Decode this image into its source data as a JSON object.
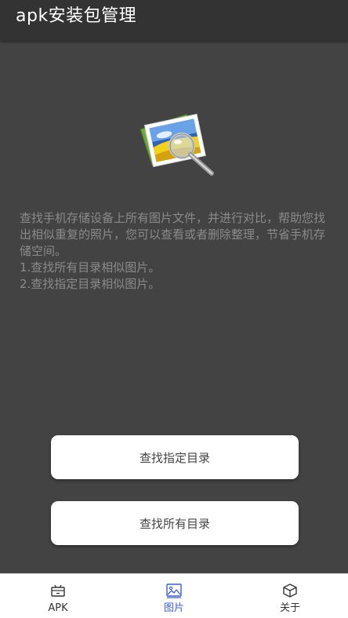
{
  "appbar": {
    "title": "apk安装包管理"
  },
  "hero": {
    "icon": "photo-search-icon"
  },
  "description": {
    "paragraph": "查找手机存储设备上所有图片文件，并进行对比，帮助您找出相似重复的照片，您可以查看或者删除整理，节省手机存储空间。",
    "item1": "1.查找所有目录相似图片。",
    "item2": "2.查找指定目录相似图片。"
  },
  "buttons": {
    "find_specific": "查找指定目录",
    "find_all": "查找所有目录"
  },
  "bottom_nav": {
    "items": [
      {
        "label": "APK",
        "icon": "apk-box-icon",
        "active": false
      },
      {
        "label": "图片",
        "icon": "image-icon",
        "active": true
      },
      {
        "label": "关于",
        "icon": "cube-icon",
        "active": false
      }
    ],
    "active_color": "#3a5fd9"
  },
  "colors": {
    "background": "#434343",
    "appbar": "#333333",
    "text_muted": "#8a8a8a"
  }
}
